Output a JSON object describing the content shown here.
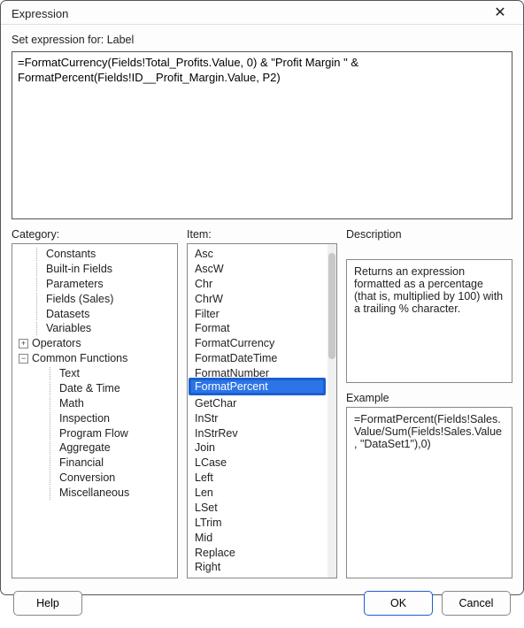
{
  "window": {
    "title": "Expression",
    "close_glyph": "✕"
  },
  "header": {
    "set_expression_label": "Set expression for: Label"
  },
  "expression": {
    "value": "=FormatCurrency(Fields!Total_Profits.Value, 0) & \"Profit Margin \" & FormatPercent(Fields!ID__Profit_Margin.Value, P2)"
  },
  "labels": {
    "category": "Category:",
    "item": "Item:",
    "description": "Description",
    "example": "Example"
  },
  "category_tree": {
    "items": [
      {
        "label": "Constants",
        "level": 1,
        "toggle": null
      },
      {
        "label": "Built-in Fields",
        "level": 1,
        "toggle": null
      },
      {
        "label": "Parameters",
        "level": 1,
        "toggle": null
      },
      {
        "label": "Fields (Sales)",
        "level": 1,
        "toggle": null
      },
      {
        "label": "Datasets",
        "level": 1,
        "toggle": null
      },
      {
        "label": "Variables",
        "level": 1,
        "toggle": null
      },
      {
        "label": "Operators",
        "level": 0,
        "toggle": "plus"
      },
      {
        "label": "Common Functions",
        "level": 0,
        "toggle": "minus"
      },
      {
        "label": "Text",
        "level": 2,
        "toggle": null,
        "selected": true
      },
      {
        "label": "Date & Time",
        "level": 2,
        "toggle": null
      },
      {
        "label": "Math",
        "level": 2,
        "toggle": null
      },
      {
        "label": "Inspection",
        "level": 2,
        "toggle": null
      },
      {
        "label": "Program Flow",
        "level": 2,
        "toggle": null
      },
      {
        "label": "Aggregate",
        "level": 2,
        "toggle": null
      },
      {
        "label": "Financial",
        "level": 2,
        "toggle": null
      },
      {
        "label": "Conversion",
        "level": 2,
        "toggle": null
      },
      {
        "label": "Miscellaneous",
        "level": 2,
        "toggle": null
      }
    ]
  },
  "item_list": {
    "items": [
      "Asc",
      "AscW",
      "Chr",
      "ChrW",
      "Filter",
      "Format",
      "FormatCurrency",
      "FormatDateTime",
      "FormatNumber",
      "FormatPercent",
      "GetChar",
      "InStr",
      "InStrRev",
      "Join",
      "LCase",
      "Left",
      "Len",
      "LSet",
      "LTrim",
      "Mid",
      "Replace",
      "Right"
    ],
    "selected_index": 9,
    "selected_label": "FormatPercent"
  },
  "description": {
    "text": "Returns an expression formatted as a percentage (that is, multiplied by 100) with a trailing % character."
  },
  "example": {
    "text": "=FormatPercent(Fields!Sales.Value/Sum(Fields!Sales.Value, \"DataSet1\"),0)"
  },
  "buttons": {
    "help": "Help",
    "ok": "OK",
    "cancel": "Cancel"
  }
}
